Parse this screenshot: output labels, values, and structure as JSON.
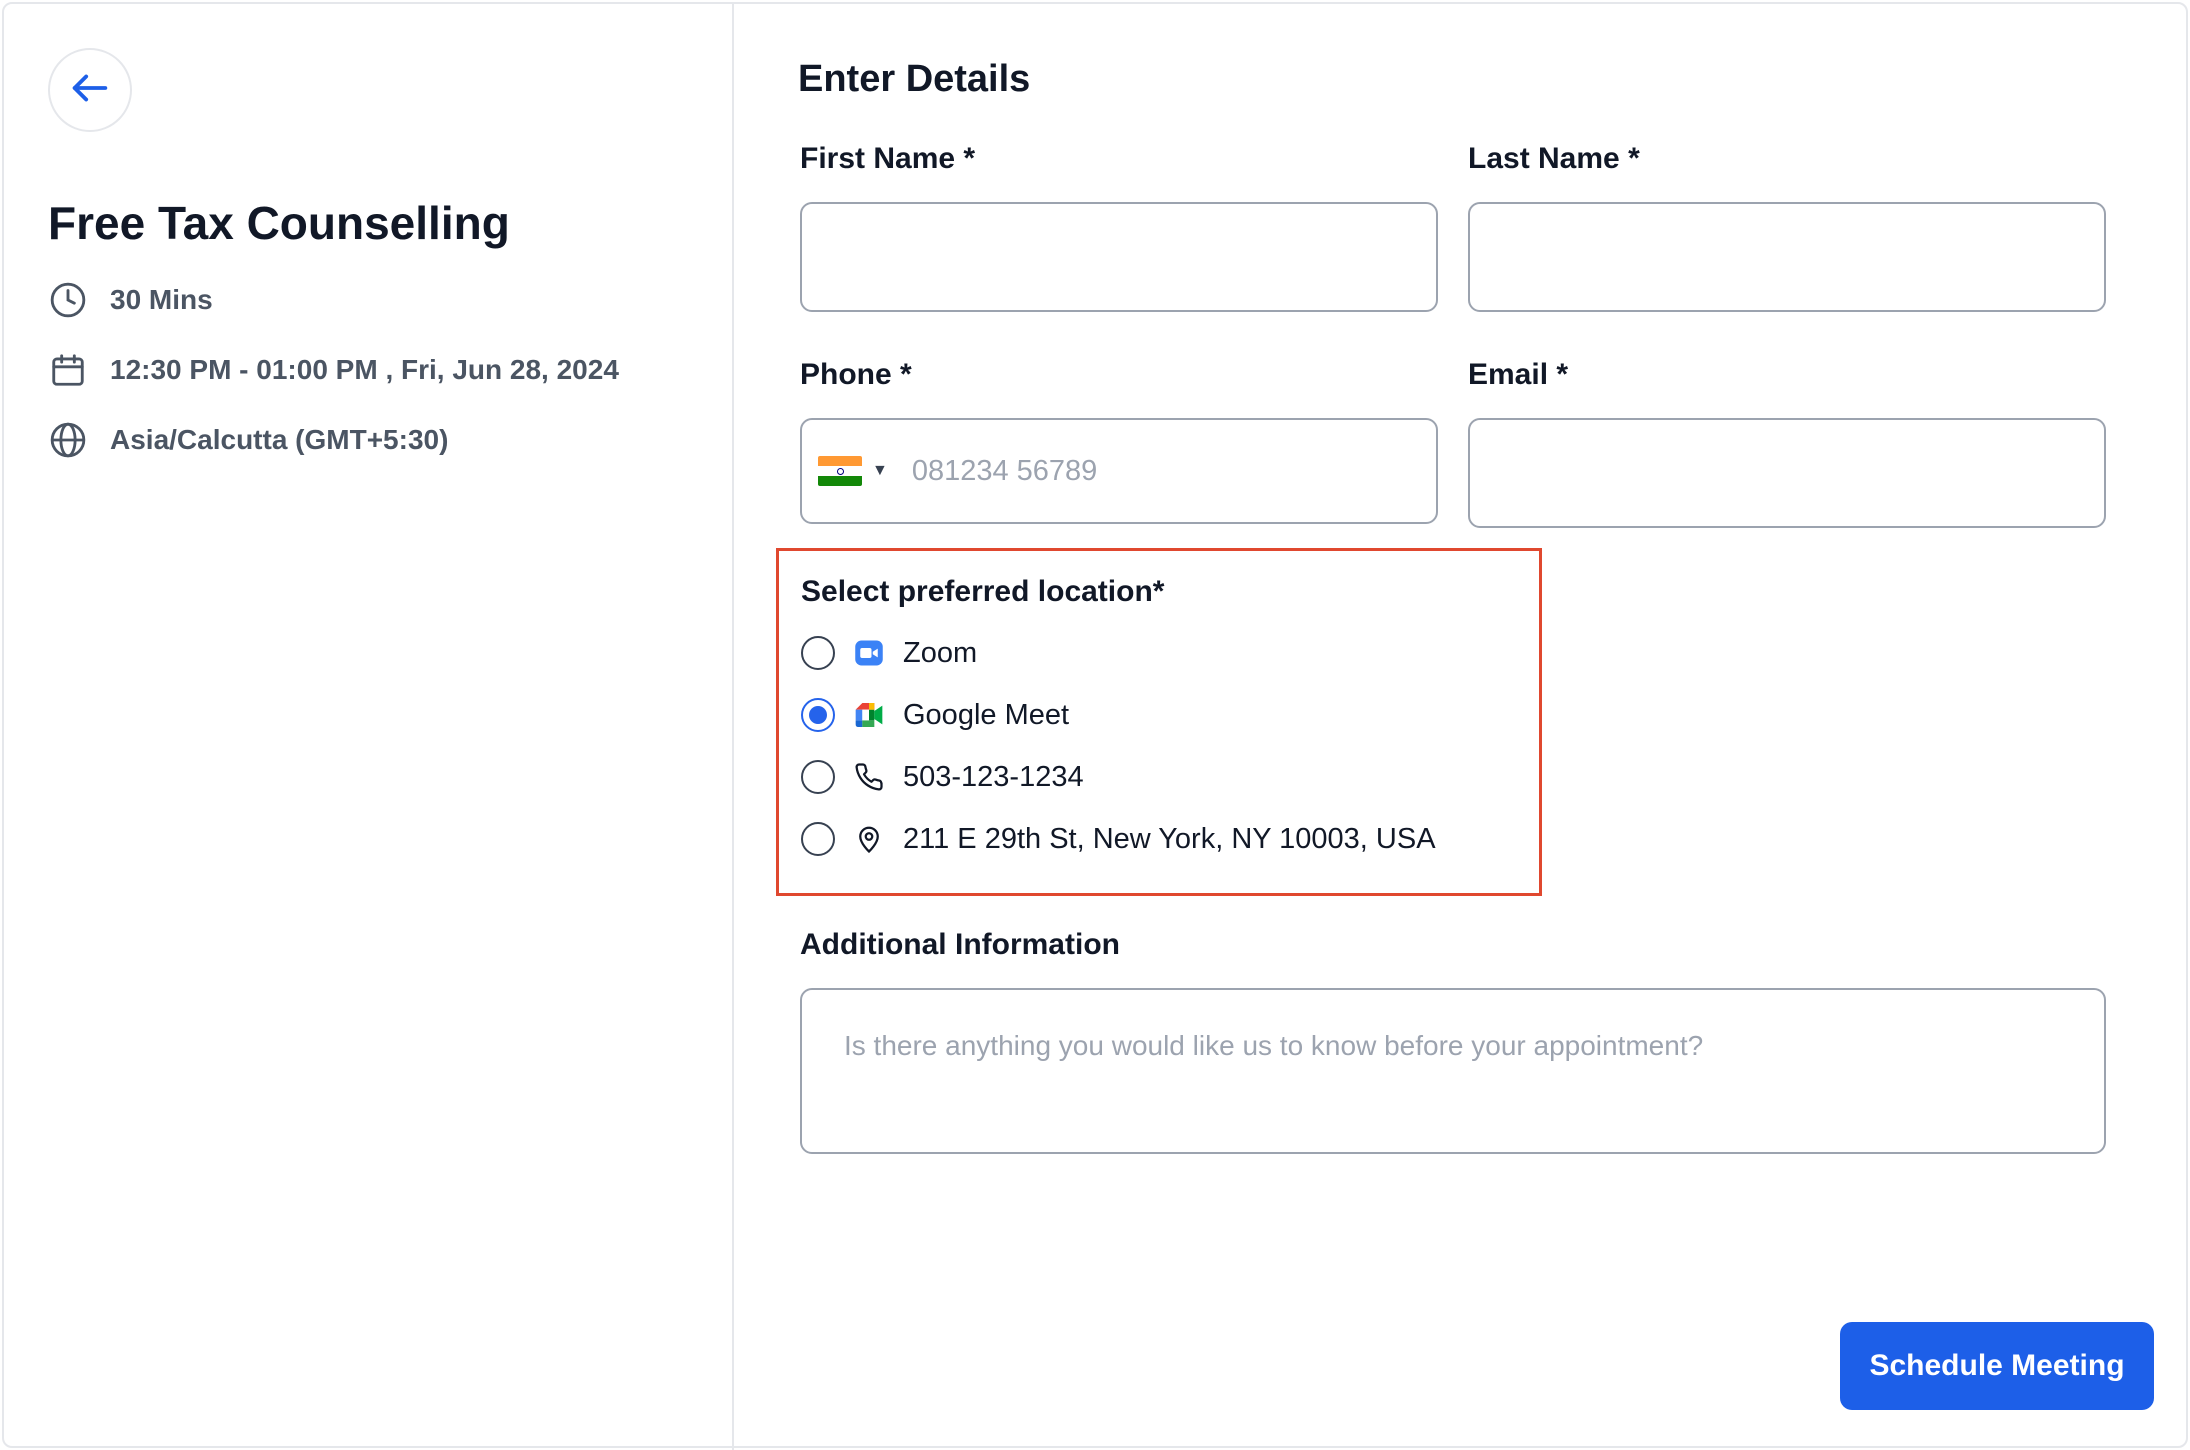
{
  "event": {
    "title": "Free Tax Counselling",
    "duration": "30 Mins",
    "datetime": "12:30 PM - 01:00 PM , Fri, Jun 28, 2024",
    "timezone": "Asia/Calcutta (GMT+5:30)"
  },
  "form": {
    "heading": "Enter Details",
    "first_name_label": "First Name *",
    "first_name_value": "",
    "last_name_label": "Last Name *",
    "last_name_value": "",
    "phone_label": "Phone *",
    "phone_placeholder": "081234 56789",
    "phone_country": "India",
    "email_label": "Email *",
    "email_value": "",
    "location": {
      "title": "Select preferred location*",
      "selected": "Google Meet",
      "options": [
        {
          "label": "Zoom",
          "icon": "zoom-icon"
        },
        {
          "label": "Google Meet",
          "icon": "google-meet-icon"
        },
        {
          "label": "503-123-1234",
          "icon": "phone-icon"
        },
        {
          "label": "211 E 29th St, New York, NY 10003, USA",
          "icon": "location-pin-icon"
        }
      ]
    },
    "additional_label": "Additional Information",
    "additional_placeholder": "Is there anything you would like us to know before your appointment?",
    "submit_label": "Schedule Meeting"
  },
  "colors": {
    "accent": "#1d5fe8",
    "highlight_border": "#e0482f"
  }
}
